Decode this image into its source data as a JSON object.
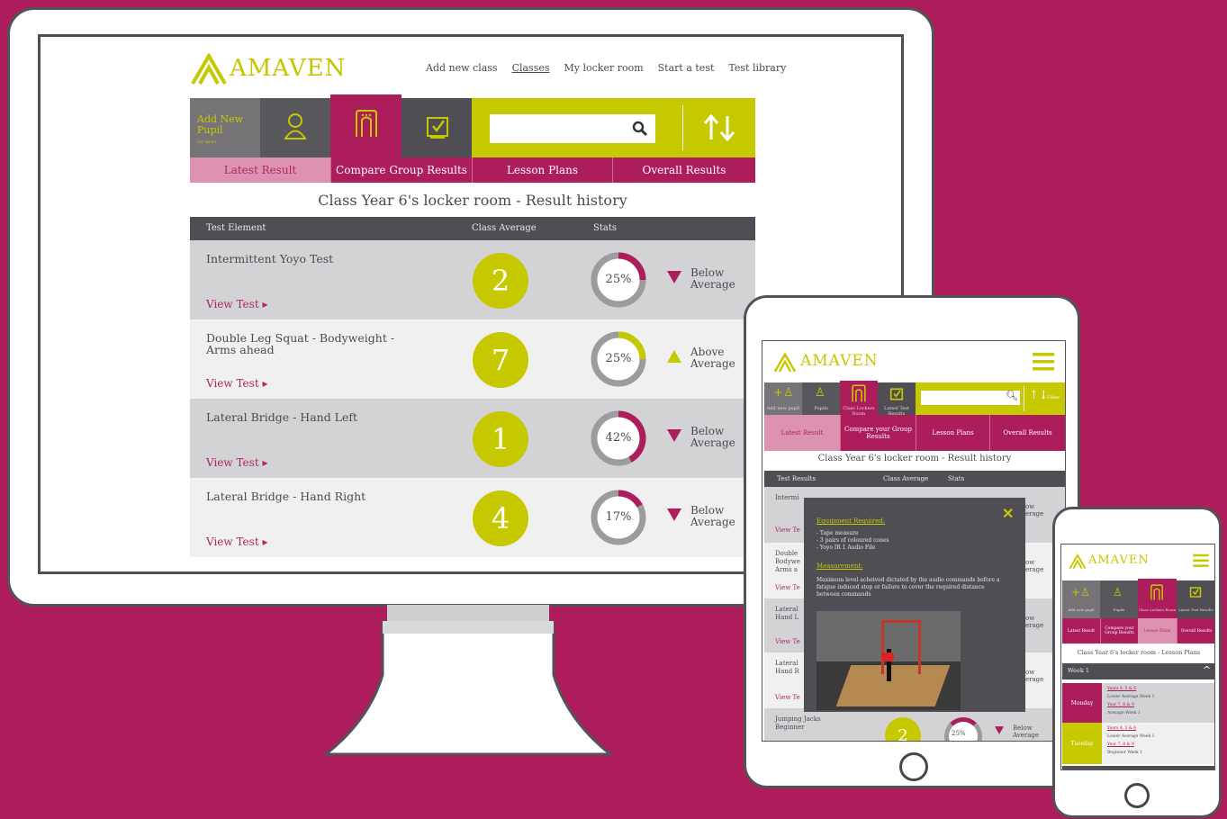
{
  "brand": {
    "name": "AMAVEN",
    "accent": "#c6c800",
    "primary": "#ad1d5c",
    "dark": "#4e4e54"
  },
  "desktop": {
    "nav": [
      "Add new class",
      "Classes",
      "My locker room",
      "Start a test",
      "Test library"
    ],
    "add_pupil": {
      "title": "Add New Pupil",
      "sub": "(or new)"
    },
    "tiles": [
      "user-icon",
      "locker-icon",
      "checklist-icon"
    ],
    "search": {
      "placeholder": ""
    },
    "tabs": [
      "Latest Result",
      "Compare Group Results",
      "Lesson Plans",
      "Overall Results"
    ],
    "title": "Class Year 6's locker room - Result history",
    "table_headers": [
      "Test Element",
      "Class Average",
      "Stats"
    ],
    "rows": [
      {
        "name": "Intermittent Yoyo Test",
        "avg": "2",
        "pct": "25%",
        "pct_value": 25,
        "status": "Below Average",
        "trend": "down",
        "view": "View Test ▸"
      },
      {
        "name": "Double Leg Squat - Bodyweight - Arms ahead",
        "avg": "7",
        "pct": "25%",
        "pct_value": 25,
        "status": "Above Average",
        "trend": "up",
        "view": "View Test ▸"
      },
      {
        "name": "Lateral Bridge - Hand Left",
        "avg": "1",
        "pct": "42%",
        "pct_value": 42,
        "status": "Below Average",
        "trend": "down",
        "view": "View Test ▸"
      },
      {
        "name": "Lateral Bridge - Hand Right",
        "avg": "4",
        "pct": "17%",
        "pct_value": 17,
        "status": "Below Average",
        "trend": "down",
        "view": "View Test ▸"
      }
    ]
  },
  "tablet": {
    "tile_labels": [
      "Add new pupil",
      "Pupils",
      "Class Lockers Room",
      "Latest Test Results"
    ],
    "filter": "Filter",
    "tabs": [
      "Latest Result",
      "Compare your Group Results",
      "Lesson Plans",
      "Overall Results"
    ],
    "title": "Class Year 6's locker room - Result history",
    "table_headers": [
      "Test Results",
      "Class Average",
      "Stats"
    ],
    "rows_visible": [
      "Intermi",
      "View Te",
      "Double Bodywe Arms a",
      "View Te",
      "Lateral Hand L",
      "View Te",
      "Lateral Hand R",
      "View Te",
      "Jumping Jacks Beginner"
    ],
    "row_right": [
      "ow erage",
      "ow erage",
      "ow erage",
      "ow erage"
    ],
    "last_row": {
      "avg": "2",
      "pct": "25%",
      "status": "Below Average"
    },
    "modal": {
      "equip_heading": "Equipment Required:",
      "equip_items": [
        "- Tape measure",
        "- 3 pairs of coloured cones",
        "- Yoyo IR 1 Audio File"
      ],
      "measure_heading": "Measurement:",
      "measure_text": "Maximum level acheived dictated by the audio commands before a fatigue induced stop or failure to cover the required distance between commands"
    }
  },
  "phone": {
    "tile_labels": [
      "Add new pupil",
      "Pupils",
      "Class Lockers Room",
      "Latest Test Results"
    ],
    "tabs": [
      "Latest Result",
      "Compare your Group Results",
      "Lesson Plans",
      "Overall Results"
    ],
    "title": "Class Year 6's locker room - Lesson Plans",
    "week": "Week 1",
    "days": [
      {
        "day": "Monday",
        "lines": [
          "Years 4, 5 & 6",
          "Lower Average Week 1",
          "Year 7, 8 & 9",
          "Average Week 1"
        ]
      },
      {
        "day": "Tuesday",
        "lines": [
          "Years 4, 5 & 6",
          "Lower Average Week 1",
          "Year 7, 8 & 9",
          "Beginner Week 1"
        ]
      }
    ]
  }
}
